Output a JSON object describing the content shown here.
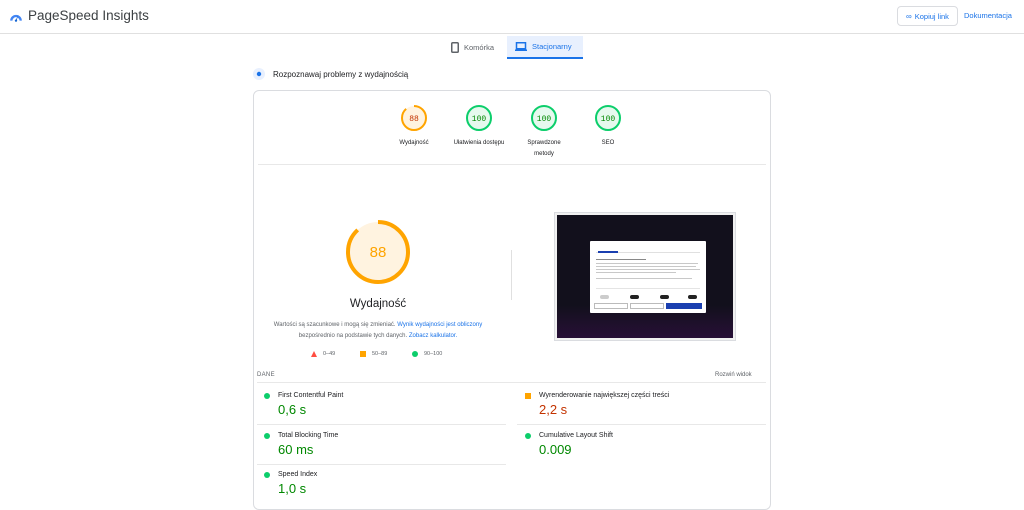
{
  "header": {
    "app_title": "PageSpeed Insights",
    "copy_link": "Kopiuj link",
    "docs": "Dokumentacja"
  },
  "device_tabs": [
    {
      "label": "Komórka",
      "icon": "smartphone-icon",
      "active": false
    },
    {
      "label": "Stacjonarny",
      "icon": "laptop-icon",
      "active": true
    }
  ],
  "section_title": "Rozpoznawaj problemy z wydajnością",
  "category_scores": [
    {
      "score": "88",
      "label": "Wydajność",
      "status": "average"
    },
    {
      "score": "100",
      "label": "Ułatwienia dostępu",
      "status": "pass"
    },
    {
      "score": "100",
      "label": "Sprawdzone metody",
      "status": "pass"
    },
    {
      "score": "100",
      "label": "SEO",
      "status": "pass"
    }
  ],
  "performance": {
    "score": "88",
    "title": "Wydajność",
    "desc_prefix": "Wartości są szacunkowe i mogą się zmieniać. ",
    "desc_link1": "Wynik wydajności jest obliczony",
    "desc_middle": " bezpośrednio na podstawie tych danych. ",
    "desc_link2": "Zobacz kalkulator."
  },
  "legend": [
    {
      "range": "0–49",
      "shape": "triangle-icon",
      "color": "#ff4e42"
    },
    {
      "range": "50–89",
      "shape": "square-icon",
      "color": "#ffa400"
    },
    {
      "range": "90–100",
      "shape": "circle-icon",
      "color": "#0cce6b"
    }
  ],
  "metrics_header": {
    "label": "DANE",
    "expand": "Rozwiń widok"
  },
  "metrics": [
    {
      "name": "First Contentful Paint",
      "value": "0,6 s",
      "status": "pass"
    },
    {
      "name": "Wyrenderowanie największej części treści",
      "value": "2,2 s",
      "status": "average"
    },
    {
      "name": "Total Blocking Time",
      "value": "60 ms",
      "status": "pass"
    },
    {
      "name": "Cumulative Layout Shift",
      "value": "0.009",
      "status": "pass"
    },
    {
      "name": "Speed Index",
      "value": "1,0 s",
      "status": "pass"
    }
  ],
  "colors": {
    "pass": "#0cce6b",
    "pass_text": "#008800",
    "average": "#ffa400",
    "average_text": "#c33300",
    "link": "#1a73e8"
  }
}
